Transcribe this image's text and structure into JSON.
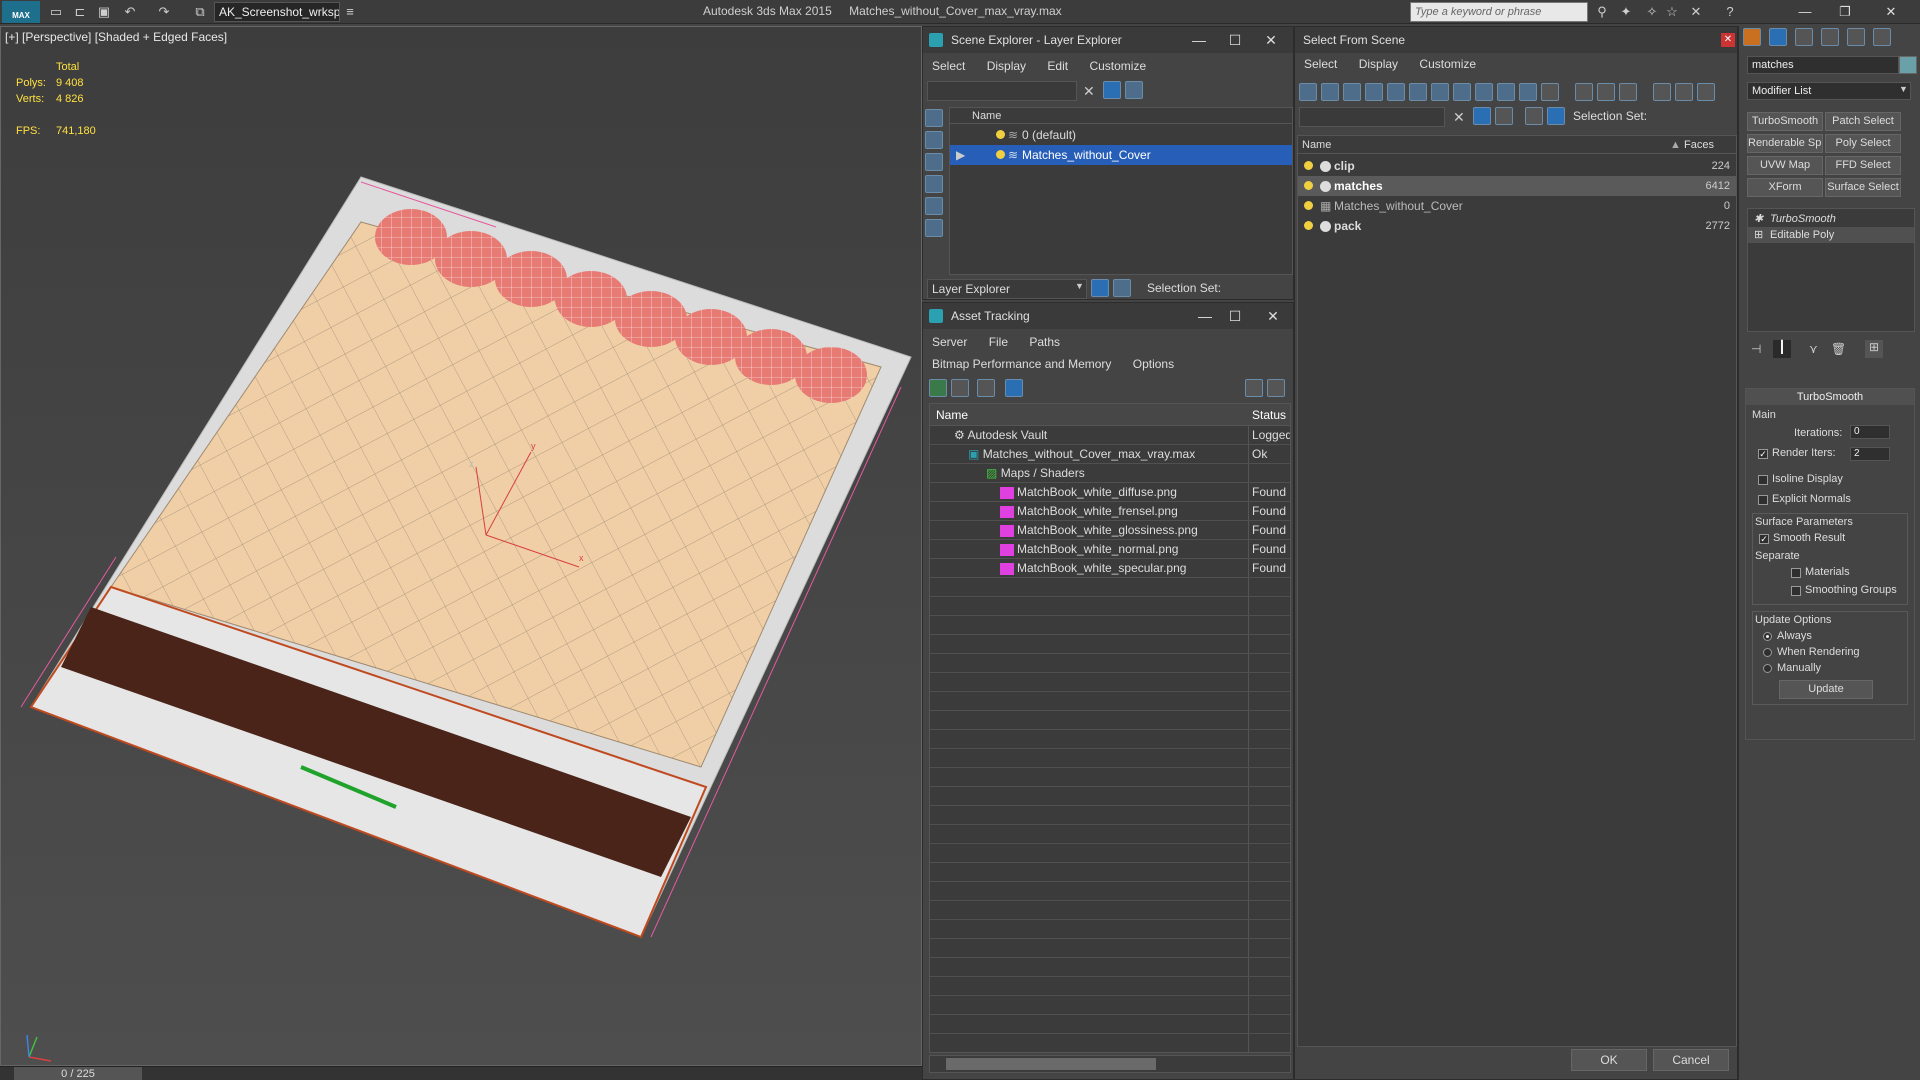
{
  "app": {
    "logo": "MAX",
    "workspace": "AK_Screenshot_wrksp",
    "title_app": "Autodesk 3ds Max  2015",
    "title_file": "Matches_without_Cover_max_vray.max",
    "search_placeholder": "Type a keyword or phrase"
  },
  "viewport": {
    "label": "[+] [Perspective] [Shaded + Edged Faces]",
    "stats": {
      "total_label": "Total",
      "polys_label": "Polys:",
      "polys_value": "9 408",
      "verts_label": "Verts:",
      "verts_value": "4 826",
      "fps_label": "FPS:",
      "fps_value": "741,180"
    },
    "axis_x": "x",
    "axis_y": "y",
    "axis_z": "z"
  },
  "timeline": {
    "frame": "0 / 225"
  },
  "scene_explorer": {
    "title": "Scene Explorer - Layer Explorer",
    "menu": [
      "Select",
      "Display",
      "Edit",
      "Customize"
    ],
    "column_name": "Name",
    "rows": [
      {
        "label": "0 (default)",
        "selected": false
      },
      {
        "label": "Matches_without_Cover",
        "selected": true
      }
    ],
    "footer_dropdown": "Layer Explorer",
    "selection_set_label": "Selection Set:"
  },
  "asset_tracking": {
    "title": "Asset Tracking",
    "menu": [
      "Server",
      "File",
      "Paths",
      "Bitmap Performance and Memory",
      "Options"
    ],
    "col_name": "Name",
    "col_status": "Status",
    "rows": [
      {
        "name": "Autodesk Vault",
        "status": "Logged",
        "indent": 0,
        "icon": "vault-icon"
      },
      {
        "name": "Matches_without_Cover_max_vray.max",
        "status": "Ok",
        "indent": 1,
        "icon": "max-file-icon"
      },
      {
        "name": "Maps / Shaders",
        "status": "",
        "indent": 2,
        "icon": "maps-icon"
      },
      {
        "name": "MatchBook_white_diffuse.png",
        "status": "Found",
        "indent": 3,
        "icon": "png-icon"
      },
      {
        "name": "MatchBook_white_frensel.png",
        "status": "Found",
        "indent": 3,
        "icon": "png-icon"
      },
      {
        "name": "MatchBook_white_glossiness.png",
        "status": "Found",
        "indent": 3,
        "icon": "png-icon"
      },
      {
        "name": "MatchBook_white_normal.png",
        "status": "Found",
        "indent": 3,
        "icon": "png-icon"
      },
      {
        "name": "MatchBook_white_specular.png",
        "status": "Found",
        "indent": 3,
        "icon": "png-icon"
      }
    ]
  },
  "select_from_scene": {
    "title": "Select From Scene",
    "menu": [
      "Select",
      "Display",
      "Customize"
    ],
    "selection_set_label": "Selection Set:",
    "col_name": "Name",
    "col_faces": "Faces",
    "rows": [
      {
        "name": "clip",
        "faces": "224",
        "bold": true,
        "highlight": false
      },
      {
        "name": "matches",
        "faces": "6412",
        "bold": true,
        "highlight": true
      },
      {
        "name": "Matches_without_Cover",
        "faces": "0",
        "bold": false,
        "highlight": false
      },
      {
        "name": "pack",
        "faces": "2772",
        "bold": true,
        "highlight": false
      }
    ],
    "ok": "OK",
    "cancel": "Cancel"
  },
  "command_panel": {
    "object_name": "matches",
    "modifier_list": "Modifier List",
    "buttons": [
      "TurboSmooth",
      "Patch Select",
      "Renderable Spline",
      "Poly Select",
      "UVW Map",
      "FFD Select",
      "XForm",
      "Surface Select"
    ],
    "stack": [
      "TurboSmooth",
      "Editable Poly"
    ],
    "rollout": {
      "title": "TurboSmooth",
      "main": "Main",
      "iterations_label": "Iterations:",
      "iterations_value": "0",
      "render_iters_label": "Render Iters:",
      "render_iters_value": "2",
      "isoline": "Isoline Display",
      "explicit_normals": "Explicit Normals",
      "surface_params": "Surface Parameters",
      "smooth_result": "Smooth Result",
      "separate": "Separate",
      "materials": "Materials",
      "smoothing_groups": "Smoothing Groups",
      "update_options": "Update Options",
      "always": "Always",
      "when_rendering": "When Rendering",
      "manually": "Manually",
      "update": "Update"
    }
  }
}
